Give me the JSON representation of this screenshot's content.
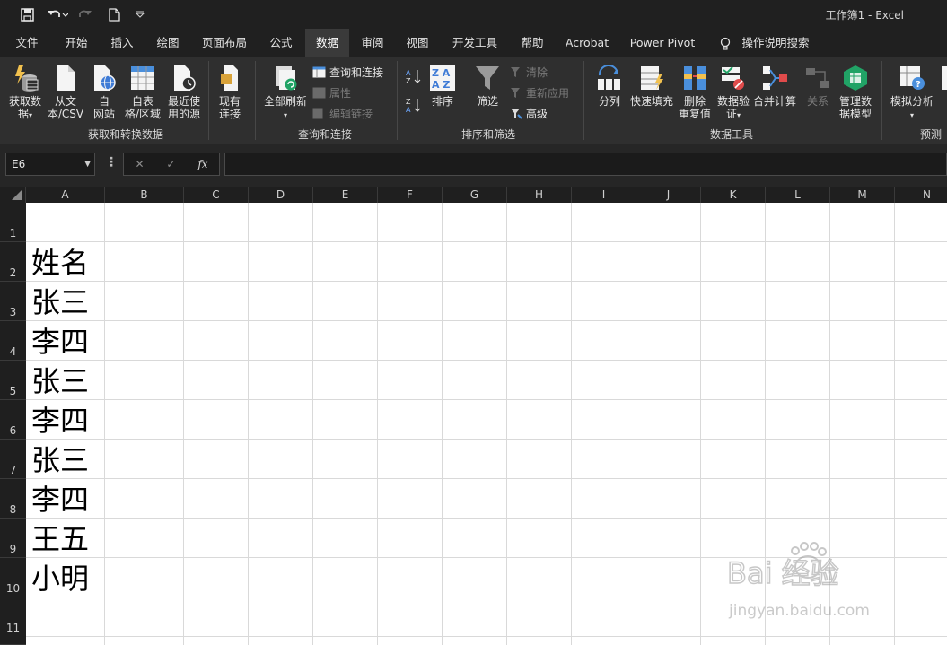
{
  "app": {
    "doc_title": "工作簿1  -  Excel"
  },
  "tabs": [
    {
      "label": "文件"
    },
    {
      "label": "开始"
    },
    {
      "label": "插入"
    },
    {
      "label": "绘图"
    },
    {
      "label": "页面布局"
    },
    {
      "label": "公式"
    },
    {
      "label": "数据",
      "active": true
    },
    {
      "label": "审阅"
    },
    {
      "label": "视图"
    },
    {
      "label": "开发工具"
    },
    {
      "label": "帮助"
    },
    {
      "label": "Acrobat"
    },
    {
      "label": "Power Pivot"
    },
    {
      "label": "操作说明搜索"
    }
  ],
  "ribbon": {
    "get_data": "获取数\n据",
    "from_csv": "从文\n本/CSV",
    "from_web": "自\n网站",
    "from_table": "自表\n格/区域",
    "recent_sources": "最近使\n用的源",
    "existing_conn": "现有\n连接",
    "group_get": "获取和转换数据",
    "refresh_all": "全部刷新",
    "queries_conn": "查询和连接",
    "properties": "属性",
    "edit_links": "编辑链接",
    "group_query": "查询和连接",
    "sort": "排序",
    "filter": "筛选",
    "clear": "清除",
    "reapply": "重新应用",
    "advanced": "高级",
    "group_sort": "排序和筛选",
    "text_to_cols": "分列",
    "flash_fill": "快速填充",
    "remove_dup": "删除\n重复值",
    "data_valid": "数据验\n证",
    "consolidate": "合并计算",
    "relations": "关系",
    "manage_model": "管理数\n据模型",
    "group_tools": "数据工具",
    "whatif": "模拟分析",
    "group_forecast": "预测"
  },
  "formula_bar": {
    "name_box": "E6",
    "fx": "fx",
    "value": ""
  },
  "columns": [
    "A",
    "B",
    "C",
    "D",
    "E",
    "F",
    "G",
    "H",
    "I",
    "J",
    "K",
    "L",
    "M",
    "N"
  ],
  "rows": [
    "1",
    "2",
    "3",
    "4",
    "5",
    "6",
    "7",
    "8",
    "9",
    "10",
    "11"
  ],
  "cells": {
    "A2": "姓名",
    "A3": "张三",
    "A4": "李四",
    "A5": "张三",
    "A6": "李四",
    "A7": "张三",
    "A8": "李四",
    "A9": "王五",
    "A10": "小明"
  },
  "watermark": {
    "brand": "Bai 经验",
    "url": "jingyan.baidu.com"
  },
  "colors": {
    "dark_bg": "#202020",
    "ribbon_bg": "#2f2f2f",
    "excel_green": "#21a366",
    "grid": "#d9d9d9"
  }
}
